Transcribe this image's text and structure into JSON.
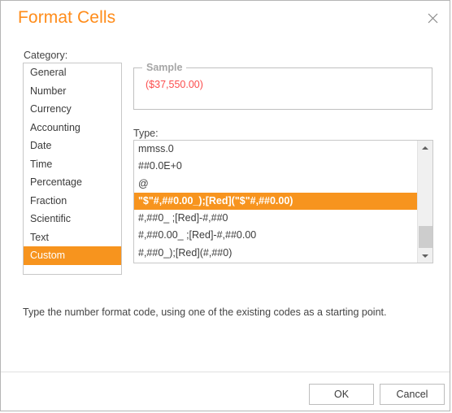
{
  "dialog": {
    "title": "Format Cells",
    "close_icon": "close-icon"
  },
  "category": {
    "label": "Category:",
    "items": [
      "General",
      "Number",
      "Currency",
      "Accounting",
      "Date",
      "Time",
      "Percentage",
      "Fraction",
      "Scientific",
      "Text",
      "Custom"
    ],
    "selected": "Custom"
  },
  "sample": {
    "legend": "Sample",
    "value": "($37,550.00)",
    "value_color": "#fc4c4c"
  },
  "type": {
    "label": "Type:",
    "items": [
      "mmss.0",
      "##0.0E+0",
      "@",
      "\"$\"#,##0.00_);[Red](\"$\"#,##0.00)",
      "#,##0_ ;[Red]-#,##0",
      "#,##0.00_ ;[Red]-#,##0.00",
      "#,##0_);[Red](#,##0)"
    ],
    "selected": "\"$\"#,##0.00_);[Red](\"$\"#,##0.00)",
    "selected_index": 3,
    "scrollbar": {
      "up_icon": "scroll-up-arrow-icon",
      "down_icon": "scroll-down-arrow-icon"
    }
  },
  "hint": "Type the number format code, using one of the existing codes as a starting point.",
  "footer": {
    "ok_label": "OK",
    "cancel_label": "Cancel"
  },
  "colors": {
    "accent": "#f7941e",
    "title": "#ff8c1a",
    "border": "#c8c8c8"
  }
}
